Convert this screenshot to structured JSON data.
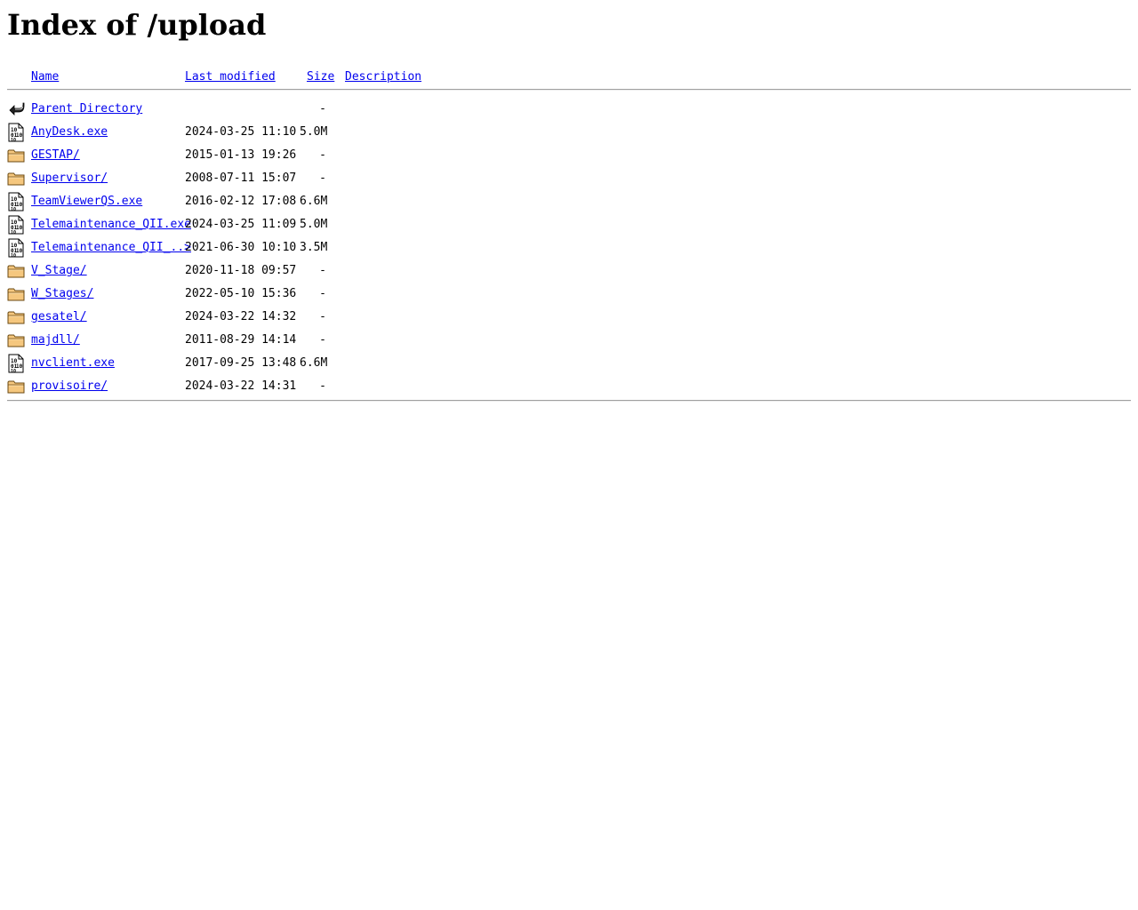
{
  "page": {
    "title": "Index of /upload"
  },
  "columns": {
    "name": "Name",
    "last_modified": "Last modified",
    "size": "Size",
    "description": "Description"
  },
  "rows": [
    {
      "icon": "back-icon",
      "name": "Parent Directory",
      "date": "",
      "size": "-"
    },
    {
      "icon": "binary-icon",
      "name": "AnyDesk.exe",
      "date": "2024-03-25 11:10",
      "size": "5.0M"
    },
    {
      "icon": "folder-icon",
      "name": "GESTAP/",
      "date": "2015-01-13 19:26",
      "size": "-"
    },
    {
      "icon": "folder-icon",
      "name": "Supervisor/",
      "date": "2008-07-11 15:07",
      "size": "-"
    },
    {
      "icon": "binary-icon",
      "name": "TeamViewerQS.exe",
      "date": "2016-02-12 17:08",
      "size": "6.6M"
    },
    {
      "icon": "binary-icon",
      "name": "Telemaintenance_QII.exe",
      "date": "2024-03-25 11:09",
      "size": "5.0M"
    },
    {
      "icon": "binary-icon",
      "name": "Telemaintenance_QII_..>",
      "date": "2021-06-30 10:10",
      "size": "3.5M"
    },
    {
      "icon": "folder-icon",
      "name": "V_Stage/",
      "date": "2020-11-18 09:57",
      "size": "-"
    },
    {
      "icon": "folder-icon",
      "name": "W_Stages/",
      "date": "2022-05-10 15:36",
      "size": "-"
    },
    {
      "icon": "folder-icon",
      "name": "gesatel/",
      "date": "2024-03-22 14:32",
      "size": "-"
    },
    {
      "icon": "folder-icon",
      "name": "majdll/",
      "date": "2011-08-29 14:14",
      "size": "-"
    },
    {
      "icon": "binary-icon",
      "name": "nvclient.exe",
      "date": "2017-09-25 13:48",
      "size": "6.6M"
    },
    {
      "icon": "folder-icon",
      "name": "provisoire/",
      "date": "2024-03-22 14:31",
      "size": "-"
    }
  ],
  "colors": {
    "link": "#0000ee",
    "folder_fill": "#f5c77e",
    "rule": "#a0a0a0"
  }
}
